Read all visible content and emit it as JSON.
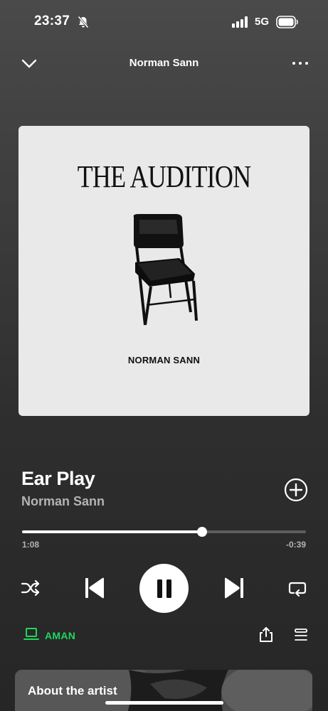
{
  "status_bar": {
    "time": "23:37",
    "network": "5G",
    "icons": [
      "bell-slash-icon",
      "signal-icon",
      "battery-icon"
    ]
  },
  "header": {
    "title": "Norman Sann",
    "icons": [
      "chevron-down-icon",
      "more-icon"
    ]
  },
  "artwork": {
    "album_title": "THE AUDITION",
    "album_artist": "NORMAN SANN",
    "image": "folding-chair"
  },
  "track": {
    "title": "Ear Play",
    "artist": "Norman Sann"
  },
  "progress": {
    "elapsed": "1:08",
    "remaining": "-0:39",
    "fraction": 0.635
  },
  "controls": {
    "icons": [
      "shuffle-icon",
      "previous-icon",
      "pause-icon",
      "next-icon",
      "repeat-icon"
    ]
  },
  "device": {
    "label": "AMAN",
    "icon": "laptop-icon"
  },
  "actions": {
    "icons": [
      "share-icon",
      "queue-icon",
      "add-icon"
    ]
  },
  "about_artist": {
    "title": "About the artist"
  },
  "colors": {
    "accent": "#1ed760",
    "background": "#2e2e2e",
    "secondary_text": "#b3b3b3"
  }
}
